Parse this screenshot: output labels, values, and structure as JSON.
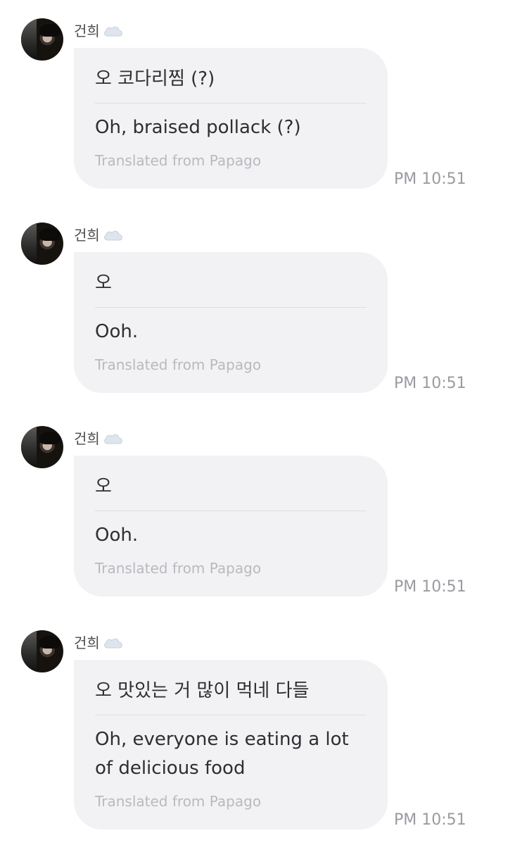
{
  "messages": [
    {
      "sender": "건희",
      "original": "오 코다리찜 (?)",
      "translation": "Oh, braised pollack (?)",
      "via": "Translated from Papago",
      "time": "PM 10:51"
    },
    {
      "sender": "건희",
      "original": "오",
      "translation": "Ooh.",
      "via": "Translated from Papago",
      "time": "PM 10:51"
    },
    {
      "sender": "건희",
      "original": "오",
      "translation": "Ooh.",
      "via": "Translated from Papago",
      "time": "PM 10:51"
    },
    {
      "sender": "건희",
      "original": "오 맛있는 거 많이 먹네 다들",
      "translation": "Oh, everyone is eating a lot of delicious food",
      "via": "Translated from Papago",
      "time": "PM 10:51"
    }
  ],
  "icons": {
    "avatar": "profile-photo",
    "cloud": "cloud-emoji"
  }
}
